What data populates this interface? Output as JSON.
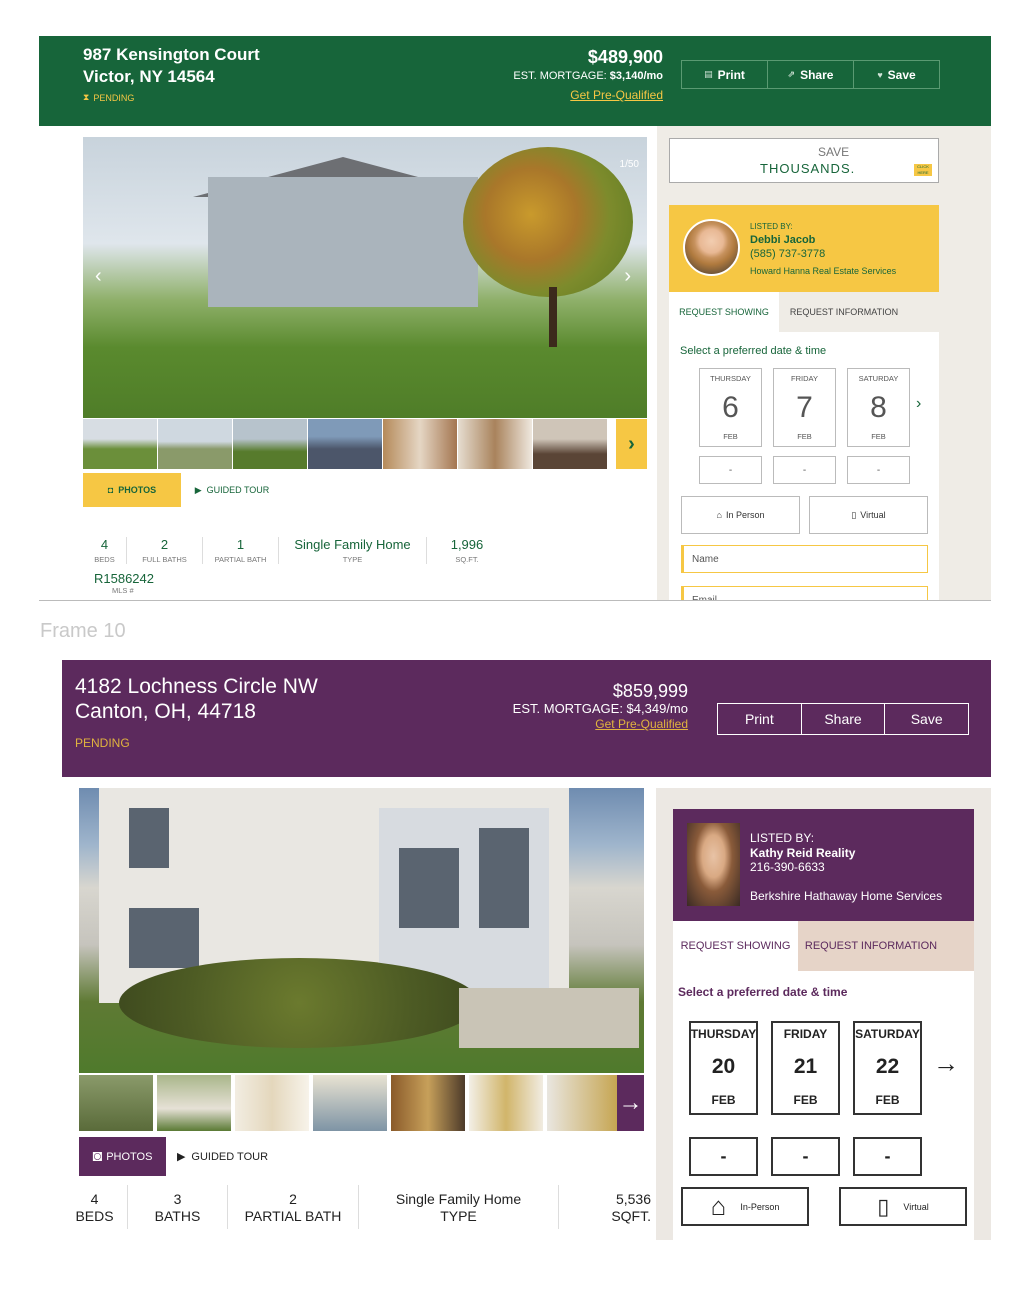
{
  "frame9": {
    "header": {
      "address_line1": "987 Kensington Court",
      "address_line2": "Victor, NY 14564",
      "status": "PENDING",
      "price": "$489,900",
      "mortgage_label": "EST. MORTGAGE:",
      "mortgage_value": "$3,140/mo",
      "prequal_link": "Get Pre-Qualified",
      "buttons": {
        "print": "Print",
        "share": "Share",
        "save": "Save"
      }
    },
    "gallery": {
      "counter": "1/50",
      "tabs": {
        "photos": "PHOTOS",
        "tour": "GUIDED TOUR"
      }
    },
    "facts": [
      {
        "value": "4",
        "label": "BEDS"
      },
      {
        "value": "2",
        "label": "FULL BATHS"
      },
      {
        "value": "1",
        "label": "PARTIAL BATH"
      },
      {
        "value": "Single Family Home",
        "label": "TYPE"
      },
      {
        "value": "1,996",
        "label": "SQ.FT."
      }
    ],
    "mls": {
      "value": "R1586242",
      "label": "MLS #"
    },
    "ad": {
      "line1": "SAVE",
      "line2": "THOUSANDS.",
      "cta": "CLICK HERE"
    },
    "agent": {
      "listed_by": "LISTED BY:",
      "name": "Debbi Jacob",
      "phone": "(585) 737-3778",
      "company": "Howard Hanna Real Estate Services"
    },
    "form": {
      "tabs": {
        "showing": "REQUEST SHOWING",
        "info": "REQUEST INFORMATION"
      },
      "prompt": "Select a preferred date & time",
      "days": [
        {
          "dow": "THURSDAY",
          "num": "6",
          "mon": "FEB"
        },
        {
          "dow": "FRIDAY",
          "num": "7",
          "mon": "FEB"
        },
        {
          "dow": "SATURDAY",
          "num": "8",
          "mon": "FEB"
        }
      ],
      "times": [
        "-",
        "-",
        "-"
      ],
      "modes": {
        "in_person": "In Person",
        "virtual": "Virtual"
      },
      "name_placeholder": "Name",
      "email_placeholder": "Email"
    },
    "colors": {
      "primary": "#17653a",
      "accent": "#f6c744"
    }
  },
  "frame_label": "Frame 10",
  "frame10": {
    "header": {
      "address_line1": "4182 Lochness Circle NW",
      "address_line2": "Canton, OH, 44718",
      "status": "PENDING",
      "price": "$859,999",
      "mortgage": "EST. MORTGAGE: $4,349/mo",
      "prequal_link": "Get Pre-Qualified",
      "buttons": {
        "print": "Print",
        "share": "Share",
        "save": "Save"
      }
    },
    "gallery": {
      "tabs": {
        "photos": "PHOTOS",
        "tour": "GUIDED TOUR"
      }
    },
    "facts": [
      {
        "value": "4",
        "label": "BEDS"
      },
      {
        "value": "3",
        "label": "BATHS"
      },
      {
        "value": "2",
        "label": "PARTIAL BATH"
      },
      {
        "value": "Single Family Home",
        "label": "TYPE"
      },
      {
        "value": "5,536",
        "label": "SQFT."
      }
    ],
    "agent": {
      "listed_by": "LISTED BY:",
      "name": "Kathy Reid Reality",
      "phone": "216-390-6633",
      "company": "Berkshire Hathaway Home Services"
    },
    "form": {
      "tabs": {
        "showing": "REQUEST SHOWING",
        "info": "REQUEST INFORMATION"
      },
      "prompt": "Select a preferred date & time",
      "days": [
        {
          "dow": "THURSDAY",
          "num": "20",
          "mon": "FEB"
        },
        {
          "dow": "FRIDAY",
          "num": "21",
          "mon": "FEB"
        },
        {
          "dow": "SATURDAY",
          "num": "22",
          "mon": "FEB"
        }
      ],
      "times": [
        "-",
        "-",
        "-"
      ],
      "modes": {
        "in_person": "In-Person",
        "virtual": "Virtual"
      }
    },
    "colors": {
      "primary": "#5c2a5d",
      "accent": "#e0b33f"
    }
  }
}
